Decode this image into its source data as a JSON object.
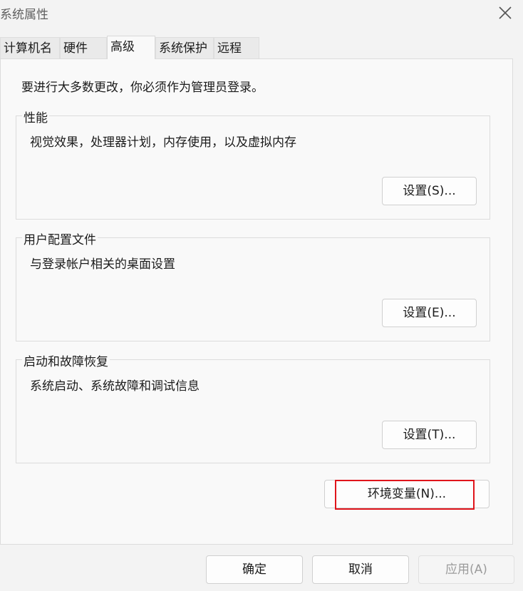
{
  "window": {
    "title": "系统属性"
  },
  "tabs": [
    {
      "label": "计算机名"
    },
    {
      "label": "硬件"
    },
    {
      "label": "高级",
      "active": true
    },
    {
      "label": "系统保护"
    },
    {
      "label": "远程"
    }
  ],
  "advanced": {
    "admin_note": "要进行大多数更改，你必须作为管理员登录。",
    "performance": {
      "title": "性能",
      "description": "视觉效果，处理器计划，内存使用，以及虚拟内存",
      "button": "设置(S)..."
    },
    "user_profiles": {
      "title": "用户配置文件",
      "description": "与登录帐户相关的桌面设置",
      "button": "设置(E)..."
    },
    "startup_recovery": {
      "title": "启动和故障恢复",
      "description": "系统启动、系统故障和调试信息",
      "button": "设置(T)..."
    },
    "env_button": "环境变量(N)..."
  },
  "footer": {
    "ok": "确定",
    "cancel": "取消",
    "apply": "应用(A)"
  },
  "colors": {
    "highlight": "#e0141b"
  }
}
